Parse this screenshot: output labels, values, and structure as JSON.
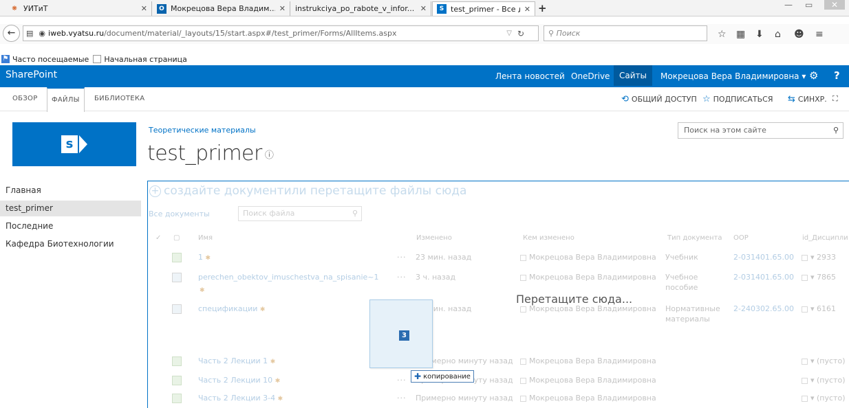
{
  "browser": {
    "tabs": [
      {
        "title": "УИТиТ",
        "favicon": "sharepoint-org-icon"
      },
      {
        "title": "Мокрецова Вера Владим...",
        "favicon": "outlook-icon"
      },
      {
        "title": "instrukciya_po_rabote_v_infor...",
        "favicon": "document-icon"
      },
      {
        "title": "test_primer - Все докумен...",
        "favicon": "sharepoint-icon"
      }
    ],
    "url_domain": "iweb.vyatsu.ru",
    "url_path": "/document/material/_layouts/15/start.aspx#/test_primer/Forms/AllItems.aspx",
    "search_placeholder": "Поиск",
    "bookmarks": [
      "Часто посещаемые",
      "Начальная страница"
    ]
  },
  "suitebar": {
    "brand": "SharePoint",
    "links": [
      "Лента новостей",
      "OneDrive",
      "Сайты"
    ],
    "user": "Мокрецова Вера Владимировна ▾",
    "accent": "#0072c6"
  },
  "ribbon": {
    "tabs": [
      "ОБЗОР",
      "ФАЙЛЫ",
      "БИБЛИОТЕКА"
    ],
    "actions": {
      "share": "ОБЩИЙ ДОСТУП",
      "follow": "ПОДПИСАТЬСЯ",
      "sync": "СИНХР."
    }
  },
  "site": {
    "logo_letter": "s",
    "breadcrumb": "Теоретические материалы",
    "title": "test_primer",
    "site_search_placeholder": "Поиск на этом сайте",
    "quicklaunch": [
      "Главная",
      "test_primer",
      "Последние",
      "Кафедра Биотехнологии"
    ]
  },
  "library": {
    "new_doc": "создайте документ",
    "new_doc_suffix": " или перетащите файлы сюда",
    "view": "Все документы",
    "find_placeholder": "Поиск файла",
    "columns": {
      "name": "Имя",
      "modified": "Изменено",
      "modified_by": "Кем изменено",
      "doc_type": "Тип документа",
      "oop": "ООР",
      "id": "id_Дисципли"
    },
    "rows": [
      {
        "name": "1",
        "modified": "23 мин. назад",
        "by": "Мокрецова Вера Владимировна",
        "type": "Учебник",
        "type2": "",
        "oop": "2-031401.65.00",
        "id": "▾ 2933"
      },
      {
        "name": "perechen_obektov_imuschestva_na_spisanie~1",
        "modified": "3 ч. назад",
        "by": "Мокрецова Вера Владимировна",
        "type": "Учебное",
        "type2": "пособие",
        "oop": "2-031401.65.00",
        "id": "▾ 7865"
      },
      {
        "name": "спецификации",
        "modified": "20 мин. назад",
        "by": "Мокрецова Вера Владимировна",
        "type": "Нормативные",
        "type2": "материалы",
        "oop": "2-240302.65.00",
        "id": "▾ 6161"
      },
      {
        "name": "Часть 2 Лекции 1",
        "modified": "Примерно минуту назад",
        "by": "Мокрецова Вера Владимировна",
        "type": "",
        "type2": "",
        "oop": "",
        "id": "▾ (пусто)"
      },
      {
        "name": "Часть 2 Лекции 10",
        "modified": "Примерно минуту назад",
        "by": "Мокрецова Вера Владимировна",
        "type": "",
        "type2": "",
        "oop": "",
        "id": "▾ (пусто)"
      },
      {
        "name": "Часть 2 Лекции 3-4",
        "modified": "Примерно минуту назад",
        "by": "Мокрецова Вера Владимировна",
        "type": "",
        "type2": "",
        "oop": "",
        "id": "▾ (пусто)"
      }
    ]
  },
  "drag": {
    "count": "3",
    "drop_message": "Перетащите сюда...",
    "copy_label": "копирование"
  }
}
